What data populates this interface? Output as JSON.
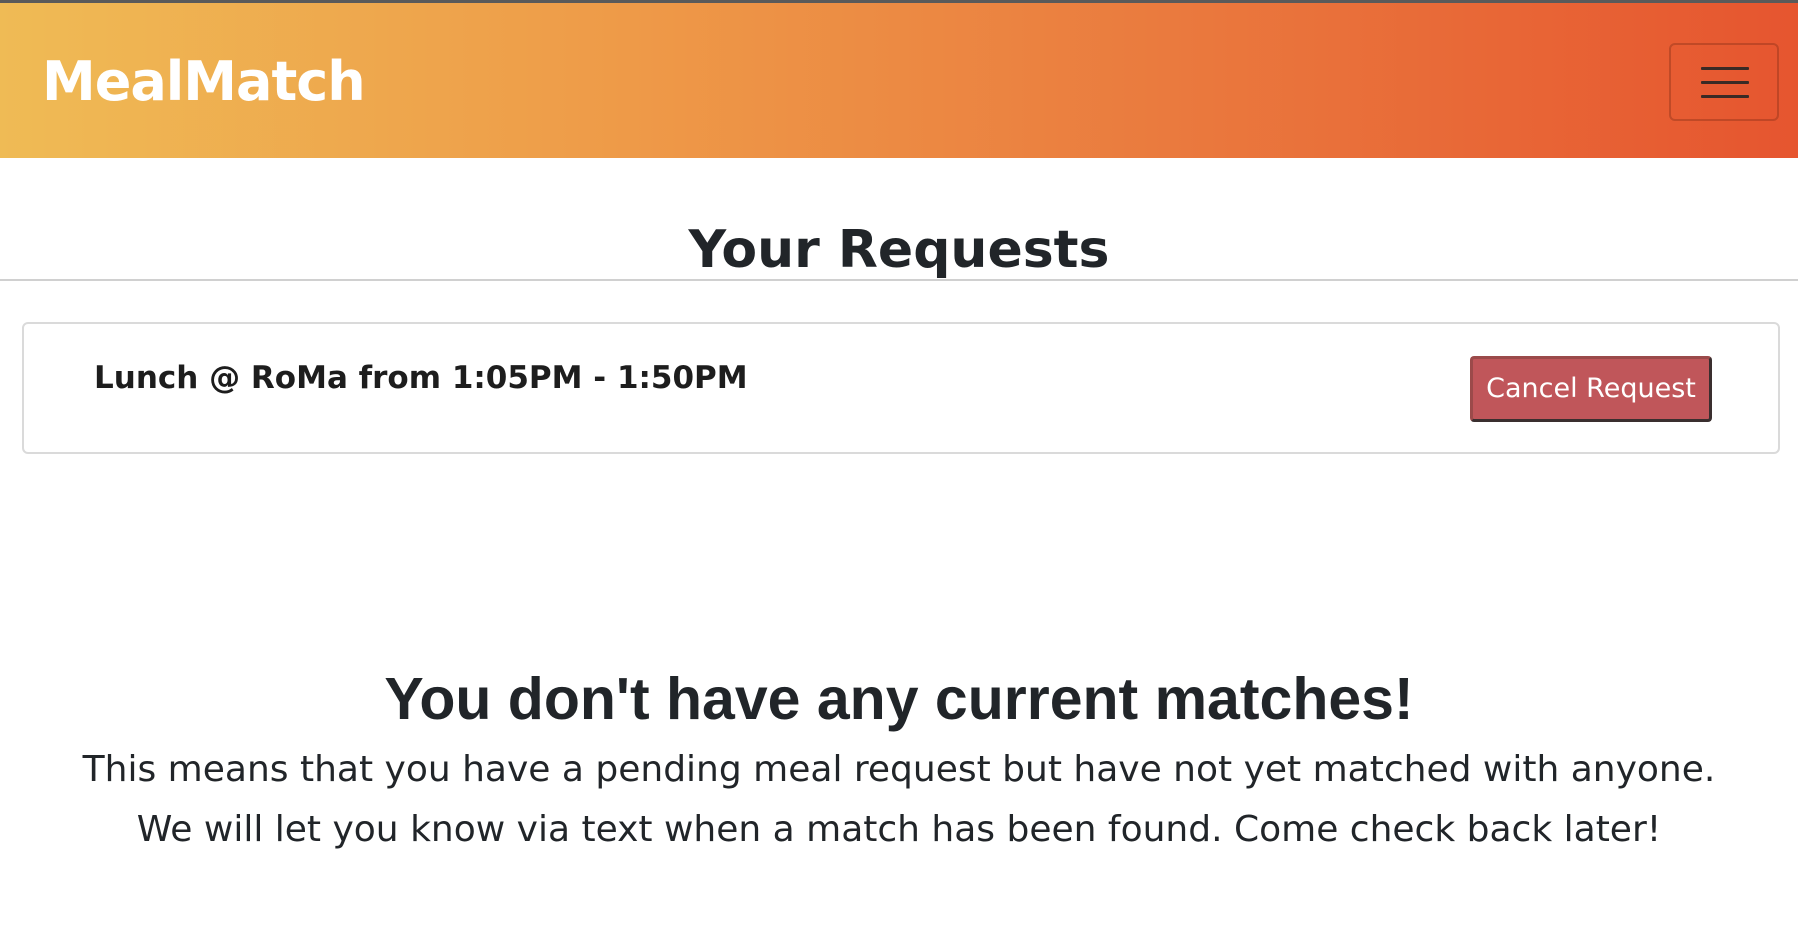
{
  "navbar": {
    "brand": "MealMatch",
    "menu_icon": "hamburger-menu-icon"
  },
  "page": {
    "title": "Your Requests"
  },
  "requests": [
    {
      "summary": "Lunch @ RoMa from 1:05PM - 1:50PM",
      "cancel_label": "Cancel Request"
    }
  ],
  "empty_state": {
    "heading": "You don't have any current matches!",
    "line1": "This means that you have a pending meal request but have not yet matched with anyone.",
    "line2": "We will let you know via text when a match has been found. Come check back later!"
  },
  "colors": {
    "navbar_gradient_start": "#efbb55",
    "navbar_gradient_end": "#e6552f",
    "cancel_button": "#c0565a"
  }
}
